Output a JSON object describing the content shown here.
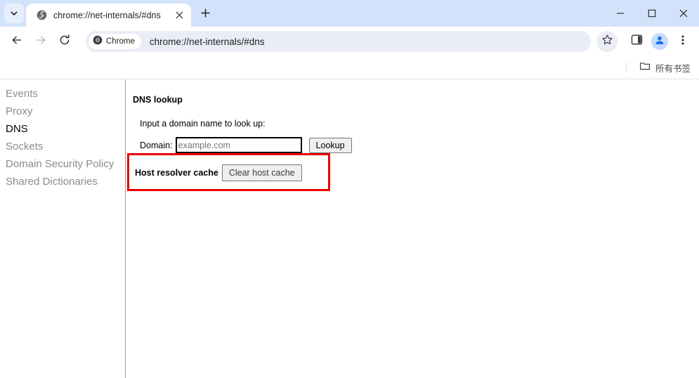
{
  "window": {
    "controls": {
      "minimize": "minimize-label",
      "maximize": "maximize-label",
      "close": "close-label"
    }
  },
  "tabstrip": {
    "tab_search_icon": "chevron-down-icon",
    "newtab_icon": "plus-icon",
    "tabs": [
      {
        "title": "chrome://net-internals/#dns",
        "favicon": "globe-icon",
        "close_icon": "close-icon",
        "active": true
      }
    ]
  },
  "toolbar": {
    "back_icon": "arrow-left-icon",
    "forward_icon": "arrow-right-icon",
    "reload_icon": "reload-icon",
    "chrome_pill_label": "Chrome",
    "chrome_pill_icon": "chrome-logo-icon",
    "url": "chrome://net-internals/#dns",
    "star_icon": "star-icon",
    "side_panel_icon": "side-panel-icon",
    "profile_icon": "profile-avatar-icon",
    "menu_icon": "three-dot-menu-icon"
  },
  "bookmarks_bar": {
    "folder_icon": "folder-icon",
    "all_bookmarks_label": "所有书签"
  },
  "sidebar": {
    "items": [
      {
        "label": "Events",
        "active": false
      },
      {
        "label": "Proxy",
        "active": false
      },
      {
        "label": "DNS",
        "active": true
      },
      {
        "label": "Sockets",
        "active": false
      },
      {
        "label": "Domain Security Policy",
        "active": false
      },
      {
        "label": "Shared Dictionaries",
        "active": false
      }
    ]
  },
  "main": {
    "section_title": "DNS lookup",
    "hint": "Input a domain name to look up:",
    "domain_label": "Domain:",
    "domain_placeholder": "example.com",
    "domain_value": "",
    "lookup_button": "Lookup",
    "host_resolver_cache_label": "Host resolver cache",
    "clear_host_cache_button": "Clear host cache"
  },
  "annotation": {
    "highlight_color": "#e60000"
  }
}
